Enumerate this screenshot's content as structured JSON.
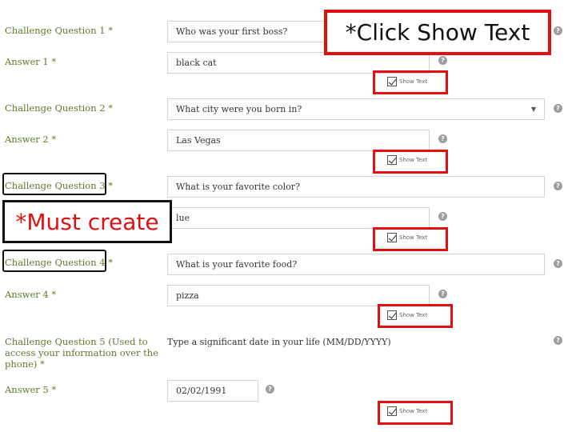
{
  "rows": [
    {
      "q_label": "Challenge Question 1 *",
      "q_value": "Who was your first boss?",
      "a_label": "Answer 1 *",
      "a_value": "black cat",
      "show_text": "Show Text"
    },
    {
      "q_label": "Challenge Question 2 *",
      "q_value": "What city were you born in?",
      "a_label": "Answer 2 *",
      "a_value": "Las Vegas",
      "show_text": "Show Text"
    },
    {
      "q_label": "Challenge Question 3 *",
      "q_value": "What is your favorite color?",
      "a_label": "",
      "a_value": "lue",
      "show_text": "Show Text"
    },
    {
      "q_label": "Challenge Question 4 *",
      "q_value": "What is your favorite food?",
      "a_label": "Answer 4 *",
      "a_value": "pizza",
      "show_text": "Show Text"
    }
  ],
  "q5": {
    "label_lines": [
      "Challenge Question 5 (Used to",
      "access your information over the",
      "phone) *"
    ],
    "prompt": "Type a significant date in your life (MM/DD/YYYY)",
    "a_label": "Answer 5 *",
    "a_value": "02/02/1991",
    "show_text": "Show Text"
  },
  "callouts": {
    "show_text": "*Click Show Text",
    "must_create": "*Must create"
  },
  "help_glyph": "?",
  "icons": {
    "help": "question-circle-icon",
    "checkbox": "checkmark-icon",
    "dropdown": "caret-down-icon"
  },
  "colors": {
    "label": "#5b7a2c",
    "annotation": "#e01010",
    "field_border": "#d4d4d4"
  }
}
